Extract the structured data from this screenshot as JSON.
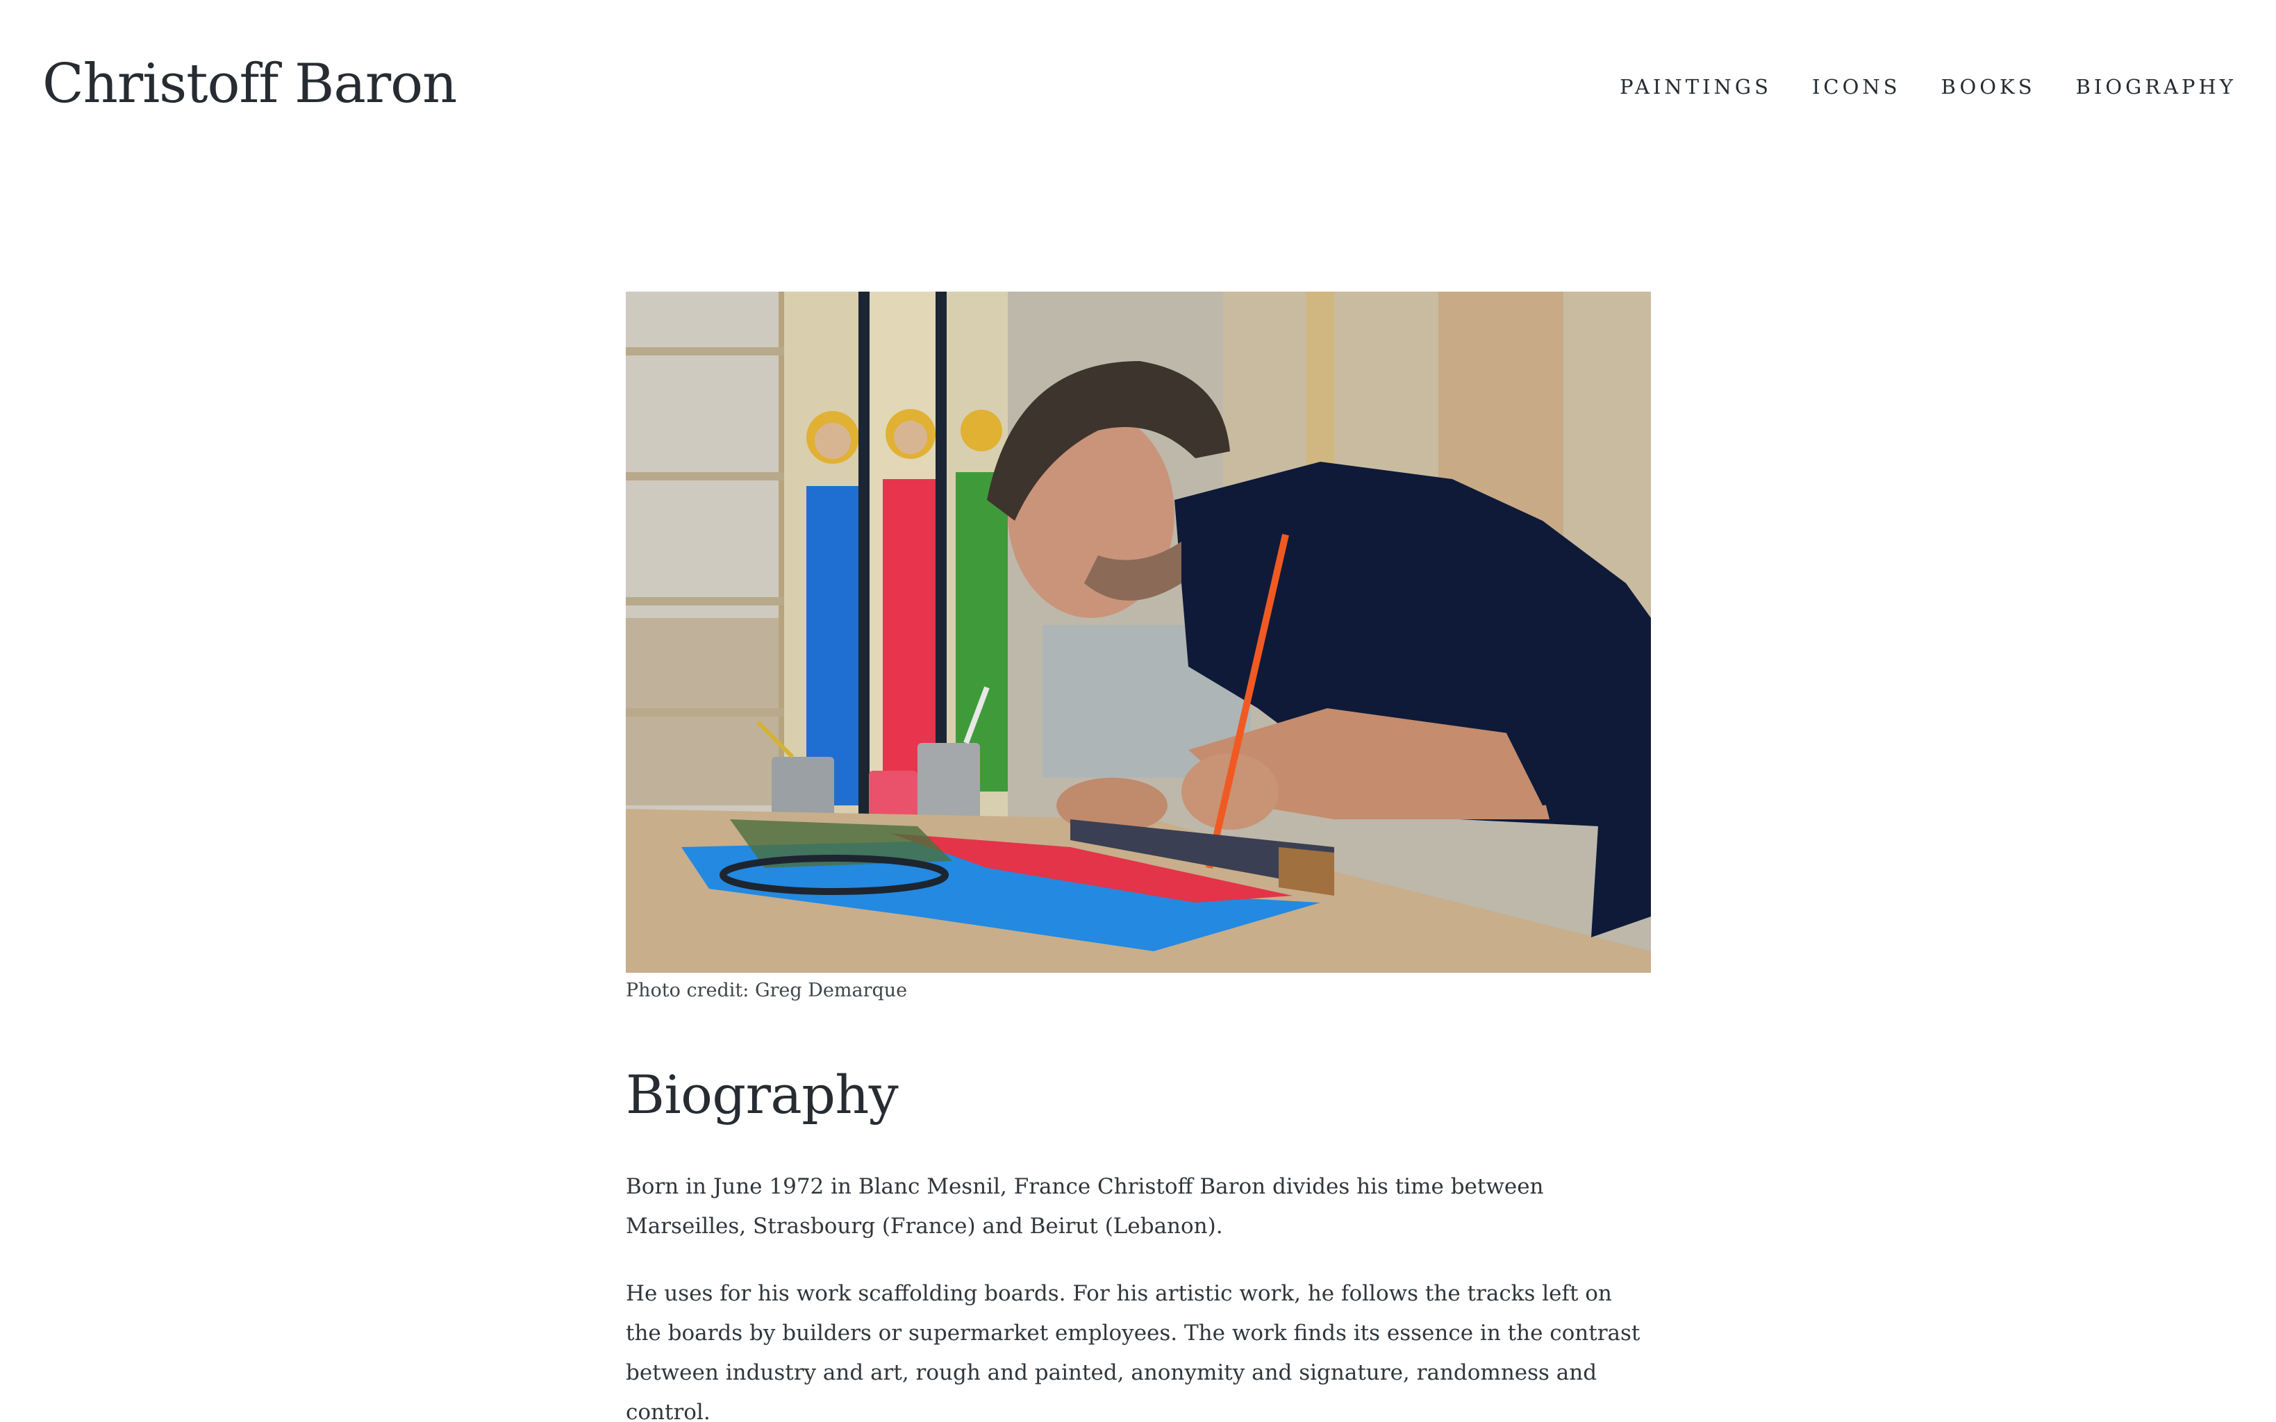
{
  "site": {
    "title": "Christoff Baron"
  },
  "nav": {
    "items": [
      {
        "label": "PAINTINGS"
      },
      {
        "label": "ICONS"
      },
      {
        "label": "BOOKS"
      },
      {
        "label": "BIOGRAPHY"
      }
    ]
  },
  "main": {
    "photo": {
      "caption": "Photo credit: Greg Demarque"
    },
    "heading": "Biography",
    "paragraphs": [
      "Born in June 1972 in Blanc Mesnil, France Christoff Baron divides his time between Marseilles, Strasbourg (France) and Beirut (Lebanon).",
      "He uses for his work scaffolding boards. For his artistic work, he follows the tracks left on the boards by builders or supermarket employees. The work finds its essence in the contrast between industry and art, rough and painted, anonymity and signature, randomness and control."
    ]
  },
  "colors": {
    "text": "#262c31",
    "background": "#ffffff"
  }
}
